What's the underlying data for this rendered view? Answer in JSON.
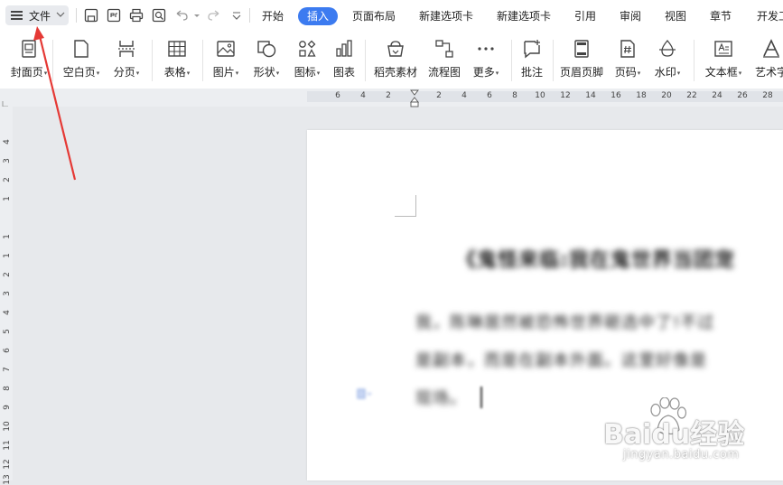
{
  "menubar": {
    "file_label": "文件",
    "tabs": [
      "开始",
      "插入",
      "页面布局",
      "新建选项卡",
      "新建选项卡",
      "引用",
      "审阅",
      "视图",
      "章节",
      "开发工"
    ],
    "active_tab": "插入"
  },
  "quick_access": {
    "icons": [
      "save-icon",
      "export-pdf-icon",
      "print-icon",
      "print-preview-icon",
      "undo-icon",
      "redo-icon",
      "customize-icon"
    ]
  },
  "ribbon": {
    "buttons": [
      {
        "label": "封面页",
        "dropdown": true
      },
      {
        "label": "空白页",
        "dropdown": true
      },
      {
        "label": "分页",
        "dropdown": true
      },
      {
        "label": "表格",
        "dropdown": true
      },
      {
        "label": "图片",
        "dropdown": true
      },
      {
        "label": "形状",
        "dropdown": true
      },
      {
        "label": "图标",
        "dropdown": true
      },
      {
        "label": "图表",
        "dropdown": false
      },
      {
        "label": "稻壳素材",
        "dropdown": false
      },
      {
        "label": "流程图",
        "dropdown": false
      },
      {
        "label": "更多",
        "dropdown": true
      },
      {
        "label": "批注",
        "dropdown": false
      },
      {
        "label": "页眉页脚",
        "dropdown": false
      },
      {
        "label": "页码",
        "dropdown": true
      },
      {
        "label": "水印",
        "dropdown": true
      },
      {
        "label": "文本框",
        "dropdown": true
      },
      {
        "label": "艺术字",
        "dropdown": false
      }
    ],
    "dropdown_glyph": "▾"
  },
  "ruler": {
    "horizontal_ticks": [
      "6",
      "4",
      "2",
      "2",
      "4",
      "6",
      "8",
      "10",
      "12",
      "14",
      "16",
      "18",
      "20",
      "22",
      "24",
      "26",
      "28"
    ],
    "vertical_ticks": [
      "4",
      "3",
      "2",
      "1",
      "1",
      "1",
      "2",
      "3",
      "4",
      "5",
      "6",
      "7",
      "8",
      "9",
      "10",
      "11",
      "12",
      "13"
    ]
  },
  "document": {
    "title": "《鬼怪来临:我在鬼世界当团宠",
    "lines": [
      "我，陈琳居然被恐怖世界砸选中了!不过",
      "是副本，而是在副本外面。这里好像是",
      "现场。"
    ]
  },
  "watermark": {
    "brand": "Baidu经验",
    "url": "jingyan.baidu.com"
  },
  "colors": {
    "accent": "#3c7bf0",
    "arrow": "#e53935"
  }
}
